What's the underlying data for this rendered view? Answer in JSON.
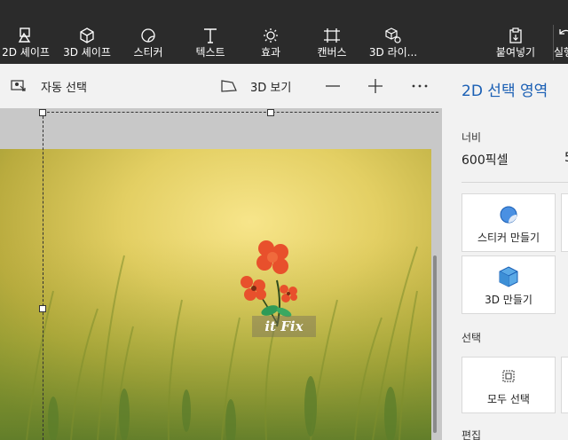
{
  "toolbar": {
    "tools": [
      {
        "label": "2D 셰이프",
        "icon": "2d-shapes-icon"
      },
      {
        "label": "3D 셰이프",
        "icon": "3d-shapes-icon"
      },
      {
        "label": "스티커",
        "icon": "stickers-icon"
      },
      {
        "label": "텍스트",
        "icon": "text-icon"
      },
      {
        "label": "효과",
        "icon": "effects-icon"
      },
      {
        "label": "캔버스",
        "icon": "canvas-icon"
      },
      {
        "label": "3D 라이...",
        "icon": "3d-library-icon"
      },
      {
        "label": "붙여넣기",
        "icon": "paste-icon"
      },
      {
        "label": "실행",
        "icon": "undo-icon"
      }
    ]
  },
  "subbar": {
    "auto_select": "자동 선택",
    "view_3d": "3D 보기",
    "zoom_out_icon": "minus-icon",
    "zoom_in_icon": "plus-icon",
    "more_icon": "ellipsis-icon"
  },
  "canvas": {
    "watermark": "it Fix"
  },
  "panel": {
    "title": "2D 선택 영역",
    "width_label": "너비",
    "width_value": "600픽셀",
    "height_value_partial": "5",
    "cards": [
      {
        "label": "스티커 만들기",
        "icon": "sticker-make-icon"
      },
      {
        "label": "3D 만들기",
        "icon": "cube-make-icon"
      }
    ],
    "select_section": "선택",
    "select_all": "모두 선택",
    "edit_section": "편집"
  },
  "colors": {
    "toolbar_bg": "#2b2b2b",
    "accent": "#1a5fb4",
    "panel_bg": "#f2f2f2"
  }
}
